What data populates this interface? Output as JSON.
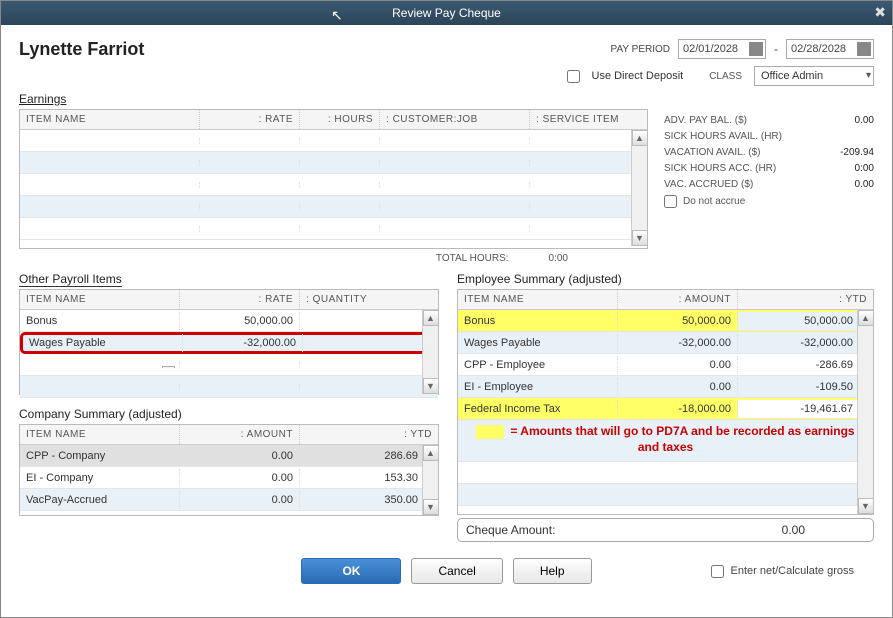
{
  "window": {
    "title": "Review Pay Cheque"
  },
  "employee": {
    "name": "Lynette Farriot"
  },
  "pay_period": {
    "label": "PAY PERIOD",
    "from": "02/01/2028",
    "to": "02/28/2028"
  },
  "direct_deposit": {
    "label": "Use Direct Deposit"
  },
  "class": {
    "label": "CLASS",
    "value": "Office Admin"
  },
  "earnings": {
    "title": "Earnings",
    "headers": {
      "item": "ITEM NAME",
      "rate": "RATE",
      "hours": "HOURS",
      "customer": "CUSTOMER:JOB",
      "service": "SERVICE ITEM"
    },
    "total_hours_label": "TOTAL HOURS:",
    "total_hours": "0:00"
  },
  "stats": {
    "adv_pay_label": "ADV. PAY BAL. ($)",
    "adv_pay": "0.00",
    "sick_avail_label": "SICK HOURS AVAIL. (HR)",
    "sick_avail": "",
    "vac_avail_label": "VACATION AVAIL. ($)",
    "vac_avail": "-209.94",
    "sick_acc_label": "SICK HOURS ACC. (HR)",
    "sick_acc": "0:00",
    "vac_acc_label": "VAC. ACCRUED ($)",
    "vac_acc": "0.00",
    "no_accrue_label": "Do not accrue"
  },
  "other_items": {
    "title": "Other Payroll Items",
    "headers": {
      "item": "ITEM NAME",
      "rate": "RATE",
      "qty": "QUANTITY"
    },
    "rows": [
      {
        "name": "Bonus",
        "rate": "50,000.00",
        "qty": "",
        "hl": false
      },
      {
        "name": "Wages Payable",
        "rate": "-32,000.00",
        "qty": "",
        "hl": true
      }
    ]
  },
  "company_summary": {
    "title": "Company Summary  (adjusted)",
    "headers": {
      "item": "ITEM NAME",
      "amount": "AMOUNT",
      "ytd": "YTD"
    },
    "rows": [
      {
        "name": "CPP - Company",
        "amount": "0.00",
        "ytd": "286.69"
      },
      {
        "name": "EI - Company",
        "amount": "0.00",
        "ytd": "153.30"
      },
      {
        "name": "VacPay-Accrued",
        "amount": "0.00",
        "ytd": "350.00"
      }
    ]
  },
  "employee_summary": {
    "title": "Employee Summary (adjusted)",
    "headers": {
      "item": "ITEM NAME",
      "amount": "AMOUNT",
      "ytd": "YTD"
    },
    "rows": [
      {
        "name": "Bonus",
        "amount": "50,000.00",
        "ytd": "50,000.00",
        "yellow": true
      },
      {
        "name": "Wages Payable",
        "amount": "-32,000.00",
        "ytd": "-32,000.00",
        "yellow": false
      },
      {
        "name": "CPP - Employee",
        "amount": "0.00",
        "ytd": "-286.69",
        "yellow": false
      },
      {
        "name": "EI - Employee",
        "amount": "0.00",
        "ytd": "-109.50",
        "yellow": false
      },
      {
        "name": "Federal Income Tax",
        "amount": "-18,000.00",
        "ytd": "-19,461.67",
        "yellow": true
      }
    ],
    "annotation": "= Amounts that will go to PD7A and be recorded as earnings and taxes"
  },
  "cheque": {
    "label": "Cheque Amount:",
    "value": "0.00"
  },
  "buttons": {
    "ok": "OK",
    "cancel": "Cancel",
    "help": "Help",
    "enter_net": "Enter net/Calculate gross"
  }
}
